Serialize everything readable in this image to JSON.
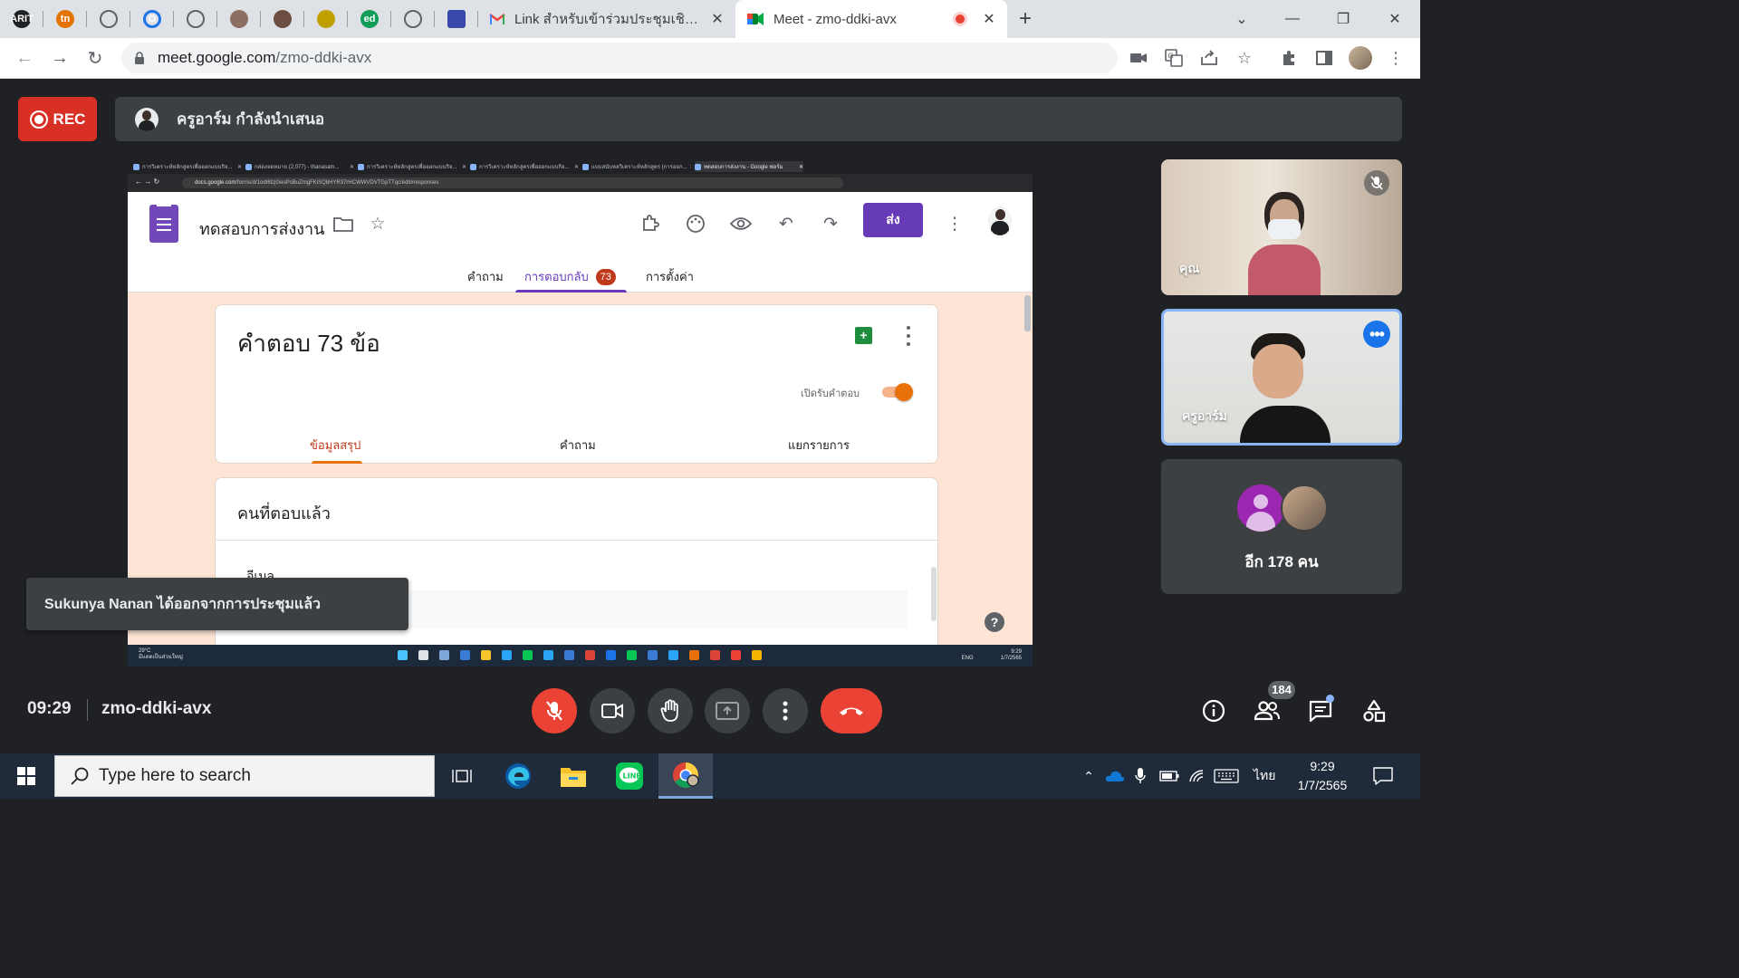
{
  "browser": {
    "pinned_tabs": [
      {
        "name": "arit-tab",
        "label": "ARIT",
        "color": "#202124"
      },
      {
        "name": "tn-tab",
        "label": "tn",
        "color": "#e37400"
      },
      {
        "name": "globe-tab-1",
        "label": "",
        "color": "#5f6368"
      },
      {
        "name": "o-tab",
        "label": "O",
        "color": "#1a73e8"
      },
      {
        "name": "globe-tab-2",
        "label": "",
        "color": "#5f6368"
      },
      {
        "name": "person-tab-1",
        "label": "",
        "color": "#8d6e63"
      },
      {
        "name": "person-tab-2",
        "label": "",
        "color": "#6d4c41"
      },
      {
        "name": "seal-tab",
        "label": "",
        "color": "#c0a000"
      },
      {
        "name": "ed-tab",
        "label": "ed",
        "color": "#0f9d58"
      },
      {
        "name": "globe-tab-3",
        "label": "",
        "color": "#5f6368"
      },
      {
        "name": "forms-tab",
        "label": "",
        "color": "#3949ab"
      }
    ],
    "tabs": [
      {
        "title": "Link สำหรับเข้าร่วมประชุมเชิงปฏิบัติการ",
        "icon": "gmail-icon",
        "active": false
      },
      {
        "title": "Meet - zmo-ddki-avx",
        "icon": "meet-icon",
        "active": true
      }
    ],
    "url_host": "meet.google.com",
    "url_path": "/zmo-ddki-avx"
  },
  "meet": {
    "rec_label": "REC",
    "presenter_text": "ครูอาร์ม กำลังนำเสนอ",
    "time": "09:29",
    "meeting_code": "zmo-ddki-avx",
    "participant_count": "184",
    "toast": "Sukunya Nanan ได้ออกจากการประชุมแล้ว",
    "tiles": [
      {
        "name": "คุณ",
        "muted": true
      },
      {
        "name": "ครูอาร์ม",
        "active_speaker": true
      },
      {
        "others_label": "อีก 178 คน"
      }
    ]
  },
  "shared_screen": {
    "mini_tabs": [
      "การวิเคราะห์หลักสูตรเพื่อออกแบบกิจ...",
      "กล่องจดหมาย (2,077) - thanasam...",
      "การวิเคราะห์หลักสูตรเพื่อออกแบบกิจ...",
      "การวิเคราะห์หลักสูตรเพื่อออกแบบกิจ...",
      "แบบสนับหลวิเคราะห์หลักสูตร (การออก...",
      "ทดสอบการส่งงาน - Google ฟอร์ม"
    ],
    "mini_url_host": "docs.google.com",
    "mini_url_path": "/forms/d/1odI6lzjGeoPsBuZmgFKiSQ8HYR37rHCWWVDVTGpTTqc/edit#responses",
    "form_title": "ทดสอบการส่งงาน",
    "send_label": "ส่ง",
    "tabs": {
      "questions": "คำถาม",
      "responses": "การตอบกลับ",
      "responses_badge": "73",
      "settings": "การตั้งค่า"
    },
    "response_count": "คำตอบ 73 ข้อ",
    "accepting_label": "เปิดรับคำตอบ",
    "accepting": true,
    "subtabs": {
      "summary": "ข้อมูลสรุป",
      "question": "คำถาม",
      "individual": "แยกรายการ"
    },
    "respondents_title": "คนที่ตอบแล้ว",
    "email_label": "อีเมล",
    "mini_taskbar": {
      "weather_temp": "29°C",
      "weather_desc": "มีแดดเป็นส่วนใหญ่",
      "lang": "ENG",
      "time": "9:29",
      "date": "1/7/2565"
    }
  },
  "taskbar": {
    "search_placeholder": "Type here to search",
    "lang": "ไทย",
    "time": "9:29",
    "date": "1/7/2565"
  },
  "colors": {
    "meet_bg": "#202124",
    "rec_red": "#d93025",
    "forms_purple": "#673ab7",
    "accent_orange": "#e8710a",
    "speaker_blue": "#8ab4f8"
  }
}
